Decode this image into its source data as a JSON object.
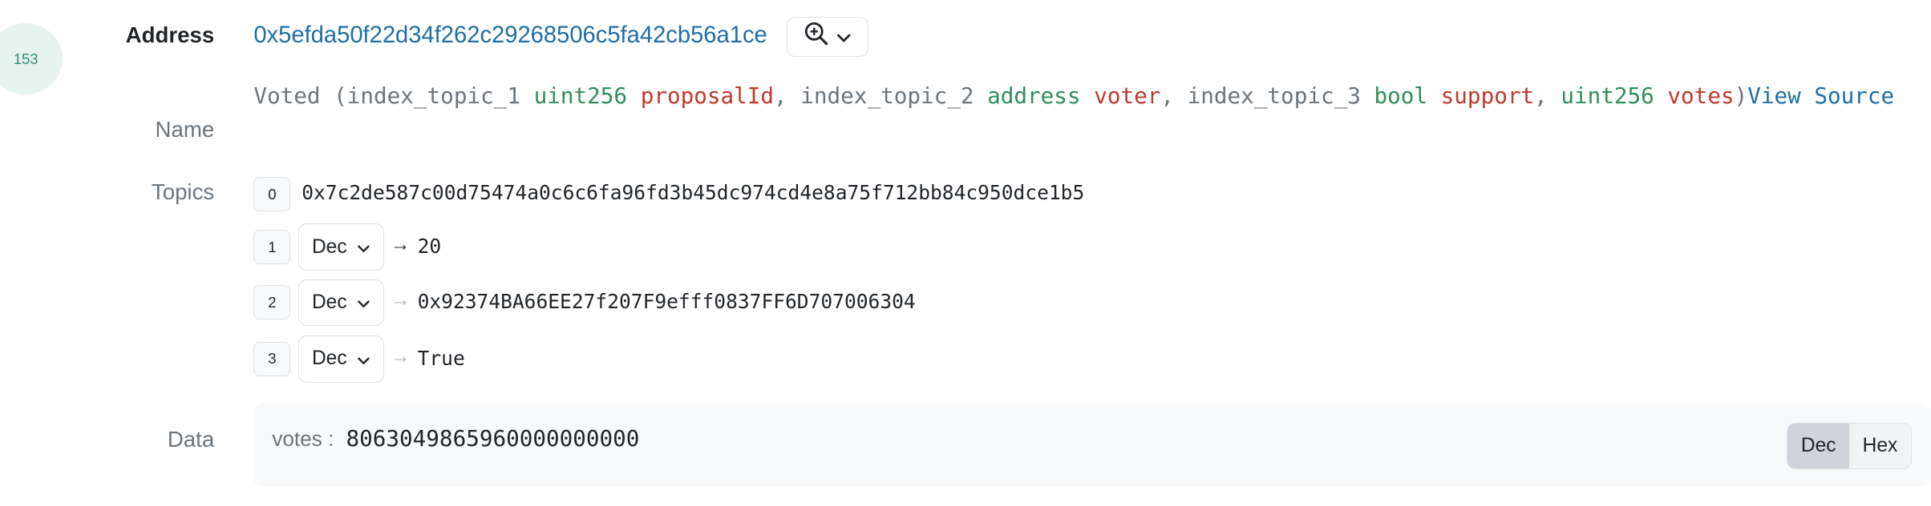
{
  "log_index": "153",
  "address": {
    "label": "Address",
    "value": "0x5efda50f22d34f262c29268506c5fa42cb56a1ce",
    "zoom_icon": "zoom-in-icon",
    "chevron_icon": "chevron-down-icon"
  },
  "name": {
    "label": "Name",
    "prefix": "Voted (",
    "params": [
      {
        "indexed": "index_topic_1",
        "type": "uint256",
        "name": "proposalId",
        "sep": ", "
      },
      {
        "indexed": "index_topic_2",
        "type": "address",
        "name": "voter",
        "sep": ", "
      },
      {
        "indexed": "index_topic_3",
        "type": "bool",
        "name": "support",
        "sep": ", "
      },
      {
        "indexed": "",
        "type": "uint256",
        "name": "votes",
        "sep": ""
      }
    ],
    "suffix": ")",
    "view_source": "View Source"
  },
  "topics": {
    "label": "Topics",
    "items": [
      {
        "index": "0",
        "value": "0x7c2de587c00d75474a0c6c6fa96fd3b45dc974cd4e8a75f712bb84c950dce1b5"
      },
      {
        "index": "1",
        "format": "Dec",
        "arrow": "→",
        "value": "20"
      },
      {
        "index": "2",
        "format": "Dec",
        "arrow": "→",
        "value": "0x92374BA66EE27f207F9efff0837FF6D707006304"
      },
      {
        "index": "3",
        "format": "Dec",
        "arrow": "→",
        "value": "True"
      }
    ]
  },
  "data": {
    "label": "Data",
    "key": "votes :",
    "value": "8063049865960000000000",
    "toggle": {
      "dec": "Dec",
      "hex": "Hex",
      "selected": "Dec"
    }
  }
}
